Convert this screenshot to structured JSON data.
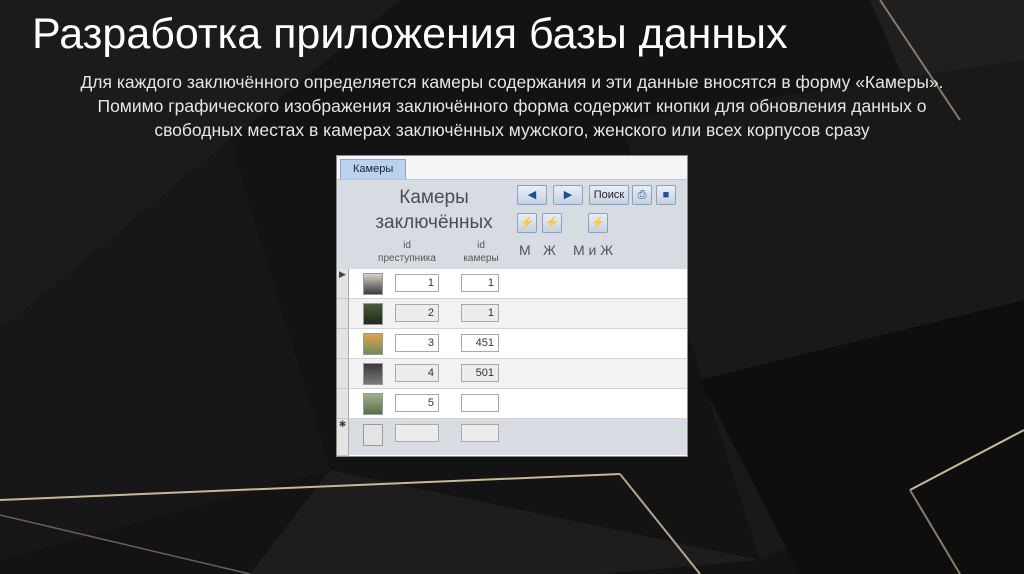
{
  "slide": {
    "title": "Разработка приложения базы данных",
    "lines": [
      "Для каждого заключённого определяется камеры содержания и эти данные вносятся в форму «Камеры».",
      "Помимо графического изображения заключённого форма содержит кнопки для обновления данных о",
      "свободных местах в камерах заключённых мужского, женского или всех корпусов сразу"
    ]
  },
  "form": {
    "tab_label": "Камеры",
    "title_line1": "Камеры",
    "title_line2": "заключённых",
    "col_prisoner_line1": "id",
    "col_prisoner_line2": "преступника",
    "col_cell_line1": "id",
    "col_cell_line2": "камеры",
    "search_label": "Поиск",
    "filter_m": "М",
    "filter_f": "Ж",
    "filter_all": "М и Ж",
    "record_selector_current": "▶",
    "record_selector_new": "✱",
    "rows": [
      {
        "prisoner_id": "1",
        "cell_id": "1"
      },
      {
        "prisoner_id": "2",
        "cell_id": "1"
      },
      {
        "prisoner_id": "3",
        "cell_id": "451"
      },
      {
        "prisoner_id": "4",
        "cell_id": "501"
      },
      {
        "prisoner_id": "5",
        "cell_id": ""
      }
    ]
  },
  "colors": {
    "form_header_bg": "#d7dce3",
    "tab_bg": "#b9d3ee",
    "button_text": "#1e4f96"
  }
}
